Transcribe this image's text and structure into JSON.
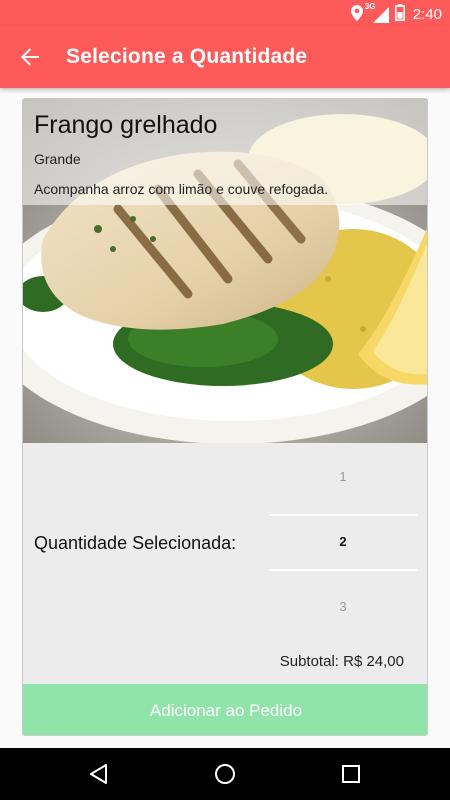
{
  "status_bar": {
    "time": "2:40",
    "network_label": "3G",
    "icons": [
      "location-icon",
      "signal-icon",
      "battery-icon"
    ]
  },
  "app_bar": {
    "title": "Selecione a Quantidade",
    "back_icon": "arrow-left-icon"
  },
  "dish": {
    "name": "Frango grelhado",
    "size": "Grande",
    "description": "Acompanha arroz com limão e couve refogada.",
    "image": "grilled-chicken-photo"
  },
  "quantity": {
    "label": "Quantidade Selecionada:",
    "options": [
      "1",
      "2",
      "3"
    ],
    "selected": "2"
  },
  "subtotal": "Subtotal: R$ 24,00",
  "add_button": "Adicionar ao Pedido",
  "colors": {
    "primary": "#ff5a5a",
    "add_button": "#90e4a9",
    "card_bg": "#ececec"
  },
  "nav": {
    "back": "back-triangle-icon",
    "home": "home-circle-icon",
    "recents": "recents-square-icon"
  }
}
